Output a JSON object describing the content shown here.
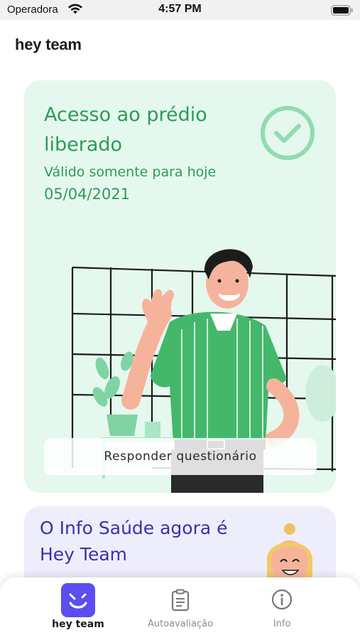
{
  "status_bar": {
    "carrier": "Operadora",
    "time": "4:57 PM"
  },
  "app": {
    "title": "hey team"
  },
  "access_card": {
    "title": "Acesso ao prédio liberado",
    "subtitle": "Válido somente para hoje",
    "date": "05/04/2021",
    "button_label": "Responder questionário",
    "accent_color": "#2c9b5a",
    "background_color": "#e5f8ee"
  },
  "info_card": {
    "title": "O Info Saúde agora é Hey Team",
    "accent_color": "#3b32a8",
    "background_color": "#eeedfc"
  },
  "bottom_nav": {
    "items": [
      {
        "label": "hey team",
        "icon": "hey-team-logo-icon",
        "active": true
      },
      {
        "label": "Autoavaliação",
        "icon": "clipboard-icon",
        "active": false
      },
      {
        "label": "Info",
        "icon": "info-icon",
        "active": false
      }
    ],
    "active_color": "#5b4df0"
  }
}
